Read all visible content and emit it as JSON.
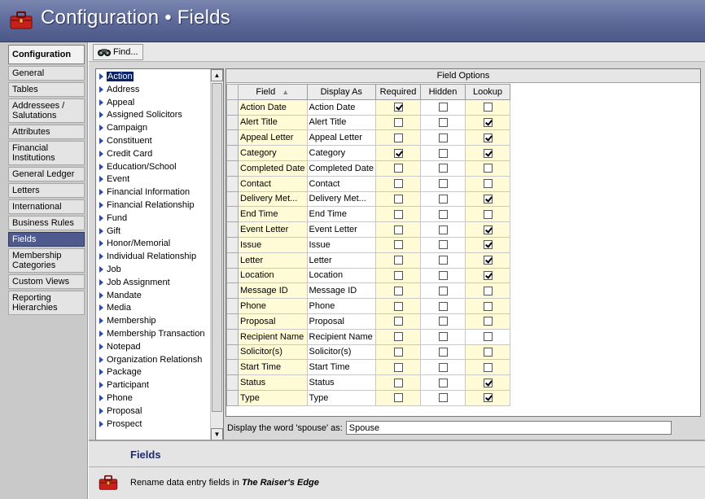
{
  "window": {
    "title": "Configuration • Fields"
  },
  "nav": {
    "header": "Configuration",
    "items": [
      {
        "label": "General"
      },
      {
        "label": "Tables"
      },
      {
        "label": "Addressees / Salutations"
      },
      {
        "label": "Attributes"
      },
      {
        "label": "Financial Institutions"
      },
      {
        "label": "General Ledger"
      },
      {
        "label": "Letters"
      },
      {
        "label": "International"
      },
      {
        "label": "Business Rules"
      },
      {
        "label": "Fields"
      },
      {
        "label": "Membership Categories"
      },
      {
        "label": "Custom Views"
      },
      {
        "label": "Reporting Hierarchies"
      }
    ],
    "selected": "Fields"
  },
  "toolbar": {
    "find_label": "Find..."
  },
  "field_list": {
    "selected": "Action",
    "items": [
      "Action",
      "Address",
      "Appeal",
      "Assigned Solicitors",
      "Campaign",
      "Constituent",
      "Credit Card",
      "Education/School",
      "Event",
      "Financial Information",
      "Financial Relationship",
      "Fund",
      "Gift",
      "Honor/Memorial",
      "Individual Relationship",
      "Job",
      "Job Assignment",
      "Mandate",
      "Media",
      "Membership",
      "Membership Transaction",
      "Notepad",
      "Organization Relationsh",
      "Package",
      "Participant",
      "Phone",
      "Proposal",
      "Prospect"
    ]
  },
  "grid": {
    "banner": "Field Options",
    "columns": [
      "Field",
      "Display As",
      "Required",
      "Hidden",
      "Lookup"
    ],
    "rows": [
      {
        "field": "Action Date",
        "display": "Action Date",
        "required": true,
        "hidden": false,
        "lookup": false
      },
      {
        "field": "Alert Title",
        "display": "Alert Title",
        "required": false,
        "hidden": false,
        "lookup": true
      },
      {
        "field": "Appeal Letter",
        "display": "Appeal Letter",
        "required": false,
        "hidden": false,
        "lookup": true
      },
      {
        "field": "Category",
        "display": "Category",
        "required": true,
        "hidden": false,
        "lookup": true
      },
      {
        "field": "Completed Date",
        "display": "Completed Date",
        "required": false,
        "hidden": false,
        "lookup": false
      },
      {
        "field": "Contact",
        "display": "Contact",
        "required": false,
        "hidden": false,
        "lookup": false
      },
      {
        "field": "Delivery Met...",
        "display": "Delivery Met...",
        "required": false,
        "hidden": false,
        "lookup": true
      },
      {
        "field": "End Time",
        "display": "End Time",
        "required": false,
        "hidden": false,
        "lookup": false
      },
      {
        "field": "Event Letter",
        "display": "Event Letter",
        "required": false,
        "hidden": false,
        "lookup": true
      },
      {
        "field": "Issue",
        "display": "Issue",
        "required": false,
        "hidden": false,
        "lookup": true
      },
      {
        "field": "Letter",
        "display": "Letter",
        "required": false,
        "hidden": false,
        "lookup": true
      },
      {
        "field": "Location",
        "display": "Location",
        "required": false,
        "hidden": false,
        "lookup": true
      },
      {
        "field": "Message ID",
        "display": "Message ID",
        "required": false,
        "hidden": false,
        "lookup": false
      },
      {
        "field": "Phone",
        "display": "Phone",
        "required": false,
        "hidden": false,
        "lookup": false
      },
      {
        "field": "Proposal",
        "display": "Proposal",
        "required": false,
        "hidden": false,
        "lookup": false
      },
      {
        "field": "Recipient Name",
        "display": "Recipient Name",
        "required": false,
        "hidden": false,
        "lookup": false
      },
      {
        "field": "Solicitor(s)",
        "display": "Solicitor(s)",
        "required": false,
        "hidden": false,
        "lookup": false
      },
      {
        "field": "Start Time",
        "display": "Start Time",
        "required": false,
        "hidden": false,
        "lookup": false
      },
      {
        "field": "Status",
        "display": "Status",
        "required": false,
        "hidden": false,
        "lookup": true
      },
      {
        "field": "Type",
        "display": "Type",
        "required": false,
        "hidden": false,
        "lookup": true
      }
    ]
  },
  "spouse": {
    "label": "Display the word 'spouse' as:",
    "value": "Spouse"
  },
  "help": {
    "title": "Fields",
    "text_prefix": "Rename data entry fields in ",
    "text_product": "The Raiser's Edge"
  },
  "colors": {
    "title_bar": "#5d6a9a",
    "selected_nav": "#4f5b8e",
    "field_cell": "#fffbd6",
    "help_title": "#1d2a6b"
  },
  "icons": {
    "app": "toolbox-icon",
    "find": "binoculars-icon"
  }
}
